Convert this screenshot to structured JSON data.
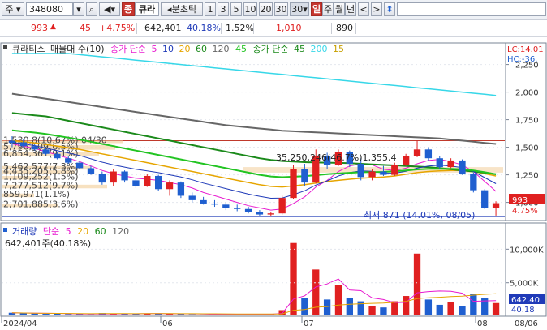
{
  "toolbar": {
    "period_label": "주",
    "code": "348080",
    "stock_name": "큐라",
    "badge": "종",
    "tick_label": "분초틱",
    "intervals": [
      "1",
      "3",
      "5",
      "10",
      "20",
      "30"
    ],
    "interval_selected": "30",
    "range_labels": [
      "일",
      "주",
      "월",
      "년"
    ]
  },
  "quote": {
    "price": "993",
    "change": "45",
    "change_pct": "+4.75%",
    "volume": "642,401",
    "volume_ratio": "40.18%",
    "turnover": "1.52%",
    "prev_value": "1,010",
    "extra_value": "890"
  },
  "legend": {
    "stock": "큐라티스",
    "indicator": "매물대 수(10)",
    "ma_label": "종가 단순",
    "ma_periods": [
      "5",
      "10",
      "20",
      "60",
      "120"
    ],
    "ma2_label": "종가 단순",
    "ma2_periods": [
      "45",
      "200",
      "15"
    ]
  },
  "colors": {
    "up": "#e02020",
    "down": "#1f5fd0",
    "ma5": "#e81ad0",
    "ma10": "#1f3ab8",
    "ma20": "#e6a500",
    "ma60": "#1b8a1b",
    "ma120": "#666666",
    "ma45": "#22c422",
    "ma200": "#37d7e8",
    "ma15": "#c8a000"
  },
  "price_axis": {
    "lc_label": "LC:14.01",
    "hc_label": "HC:-36.",
    "ticks": [
      "2,250",
      "2,000",
      "1,750",
      "1,500",
      "1,250",
      "1,000"
    ],
    "current_label": "993",
    "current_pct": "4.75%"
  },
  "volume_profile": [
    {
      "label": "1,530,8(10.67%) 04/30"
    },
    {
      "label": "5,796,509(6.5%)"
    },
    {
      "label": "6,854,361(9.1%)"
    },
    {
      "label": "5,462,577(7.3%)"
    },
    {
      "label": "4,435,205(5.8%)"
    },
    {
      "label": "1,109,252(1.5%)"
    },
    {
      "label": "7,277,512(9.7%)"
    },
    {
      "label": "859,971(1.1%)"
    },
    {
      "label": "2,701,885(3.6%)"
    }
  ],
  "annotations": {
    "mid_profile": "35,250,246(46.7%)1,355,4",
    "low_marker": "최저 871 (14.01%, 08/05)"
  },
  "volume_legend": {
    "title": "거래량",
    "ma_label": "단순",
    "periods": [
      "5",
      "20",
      "60",
      "120"
    ],
    "current": "642,401주(40.18%)"
  },
  "volume_axis": {
    "ticks": [
      "10,000K",
      "5,000K"
    ],
    "current_label": "642,40",
    "current_pct": "40.18"
  },
  "date_axis": [
    "2024/04",
    "06",
    "07",
    "08",
    "08/06"
  ],
  "chart_data": {
    "type": "candlestick",
    "note_ylim": [
      850,
      2350
    ],
    "candles": [
      [
        1560,
        1600,
        1500,
        1540
      ],
      [
        1545,
        1570,
        1490,
        1510
      ],
      [
        1510,
        1530,
        1470,
        1480
      ],
      [
        1480,
        1500,
        1430,
        1440
      ],
      [
        1440,
        1460,
        1390,
        1400
      ],
      [
        1400,
        1420,
        1350,
        1360
      ],
      [
        1360,
        1380,
        1300,
        1310
      ],
      [
        1310,
        1330,
        1250,
        1260
      ],
      [
        1260,
        1280,
        1160,
        1180
      ],
      [
        1180,
        1300,
        1150,
        1280
      ],
      [
        1280,
        1290,
        1180,
        1200
      ],
      [
        1200,
        1230,
        1130,
        1150
      ],
      [
        1150,
        1260,
        1140,
        1240
      ],
      [
        1240,
        1250,
        1100,
        1120
      ],
      [
        1120,
        1200,
        1060,
        1180
      ],
      [
        1180,
        1190,
        1040,
        1060
      ],
      [
        1060,
        1090,
        1000,
        1020
      ],
      [
        1020,
        1050,
        980,
        990
      ],
      [
        990,
        1020,
        960,
        980
      ],
      [
        980,
        1000,
        930,
        950
      ],
      [
        950,
        980,
        920,
        940
      ],
      [
        940,
        960,
        900,
        910
      ],
      [
        910,
        930,
        880,
        890
      ],
      [
        890,
        910,
        871,
        900
      ],
      [
        900,
        1060,
        890,
        1040
      ],
      [
        1040,
        1340,
        1030,
        1300
      ],
      [
        1300,
        1350,
        1150,
        1180
      ],
      [
        1180,
        1480,
        1170,
        1420
      ],
      [
        1420,
        1450,
        1300,
        1340
      ],
      [
        1340,
        1480,
        1330,
        1460
      ],
      [
        1460,
        1470,
        1320,
        1350
      ],
      [
        1350,
        1400,
        1200,
        1230
      ],
      [
        1230,
        1300,
        1200,
        1280
      ],
      [
        1280,
        1330,
        1240,
        1250
      ],
      [
        1250,
        1360,
        1240,
        1340
      ],
      [
        1340,
        1440,
        1330,
        1420
      ],
      [
        1420,
        1560,
        1410,
        1480
      ],
      [
        1480,
        1500,
        1380,
        1400
      ],
      [
        1400,
        1420,
        1300,
        1320
      ],
      [
        1320,
        1400,
        1310,
        1380
      ],
      [
        1380,
        1390,
        1250,
        1260
      ],
      [
        1260,
        1270,
        1090,
        1110
      ],
      [
        1110,
        1120,
        940,
        948
      ],
      [
        948,
        1010,
        880,
        993
      ]
    ],
    "volumes": [
      30,
      25,
      22,
      18,
      20,
      15,
      14,
      12,
      26,
      20,
      18,
      16,
      22,
      24,
      18,
      14,
      12,
      10,
      10,
      9,
      12,
      11,
      14,
      16,
      60,
      820,
      200,
      520,
      180,
      340,
      200,
      160,
      110,
      90,
      160,
      220,
      700,
      180,
      120,
      150,
      110,
      240,
      200,
      140
    ],
    "ma_lines": {
      "ma5": [
        1530,
        1510,
        1490,
        1460,
        1430,
        1400,
        1370,
        1330,
        1290,
        1260,
        1240,
        1220,
        1210,
        1200,
        1180,
        1160,
        1130,
        1090,
        1060,
        1030,
        1000,
        970,
        950,
        930,
        940,
        990,
        1050,
        1140,
        1200,
        1280,
        1330,
        1350,
        1340,
        1300,
        1290,
        1310,
        1350,
        1380,
        1390,
        1370,
        1340,
        1280,
        1190,
        1100
      ],
      "ma20": [
        1560,
        1550,
        1540,
        1525,
        1510,
        1495,
        1480,
        1460,
        1440,
        1420,
        1400,
        1380,
        1360,
        1340,
        1320,
        1300,
        1280,
        1260,
        1240,
        1220,
        1200,
        1180,
        1160,
        1145,
        1140,
        1150,
        1160,
        1175,
        1190,
        1200,
        1210,
        1220,
        1225,
        1230,
        1240,
        1255,
        1270,
        1280,
        1285,
        1290,
        1290,
        1280,
        1260,
        1240
      ],
      "ma60": [
        1810,
        1800,
        1790,
        1780,
        1760,
        1740,
        1720,
        1700,
        1680,
        1660,
        1640,
        1620,
        1600,
        1580,
        1560,
        1540,
        1520,
        1500,
        1480,
        1460,
        1440,
        1420,
        1400,
        1385,
        1375,
        1370,
        1365,
        1362,
        1360,
        1358,
        1355,
        1350,
        1345,
        1340,
        1335,
        1330,
        1325,
        1320,
        1310,
        1300,
        1290,
        1280,
        1270,
        1255
      ],
      "ma120": [
        1985,
        1970,
        1955,
        1940,
        1925,
        1910,
        1895,
        1880,
        1865,
        1850,
        1835,
        1820,
        1805,
        1790,
        1775,
        1760,
        1745,
        1730,
        1715,
        1700,
        1690,
        1680,
        1670,
        1660,
        1650,
        1645,
        1640,
        1635,
        1630,
        1625,
        1620,
        1615,
        1610,
        1605,
        1600,
        1595,
        1590,
        1585,
        1580,
        1570,
        1560,
        1550,
        1540,
        1530
      ],
      "ma200": [
        2400,
        2390,
        2380,
        2370,
        2360,
        2350,
        2340,
        2330,
        2320,
        2310,
        2300,
        2290,
        2280,
        2270,
        2260,
        2250,
        2240,
        2230,
        2220,
        2210,
        2200,
        2190,
        2180,
        2170,
        2160,
        2150,
        2140,
        2130,
        2120,
        2110,
        2100,
        2090,
        2080,
        2070,
        2060,
        2050,
        2040,
        2030,
        2020,
        2010,
        2000,
        1990,
        1980,
        1970
      ]
    }
  }
}
